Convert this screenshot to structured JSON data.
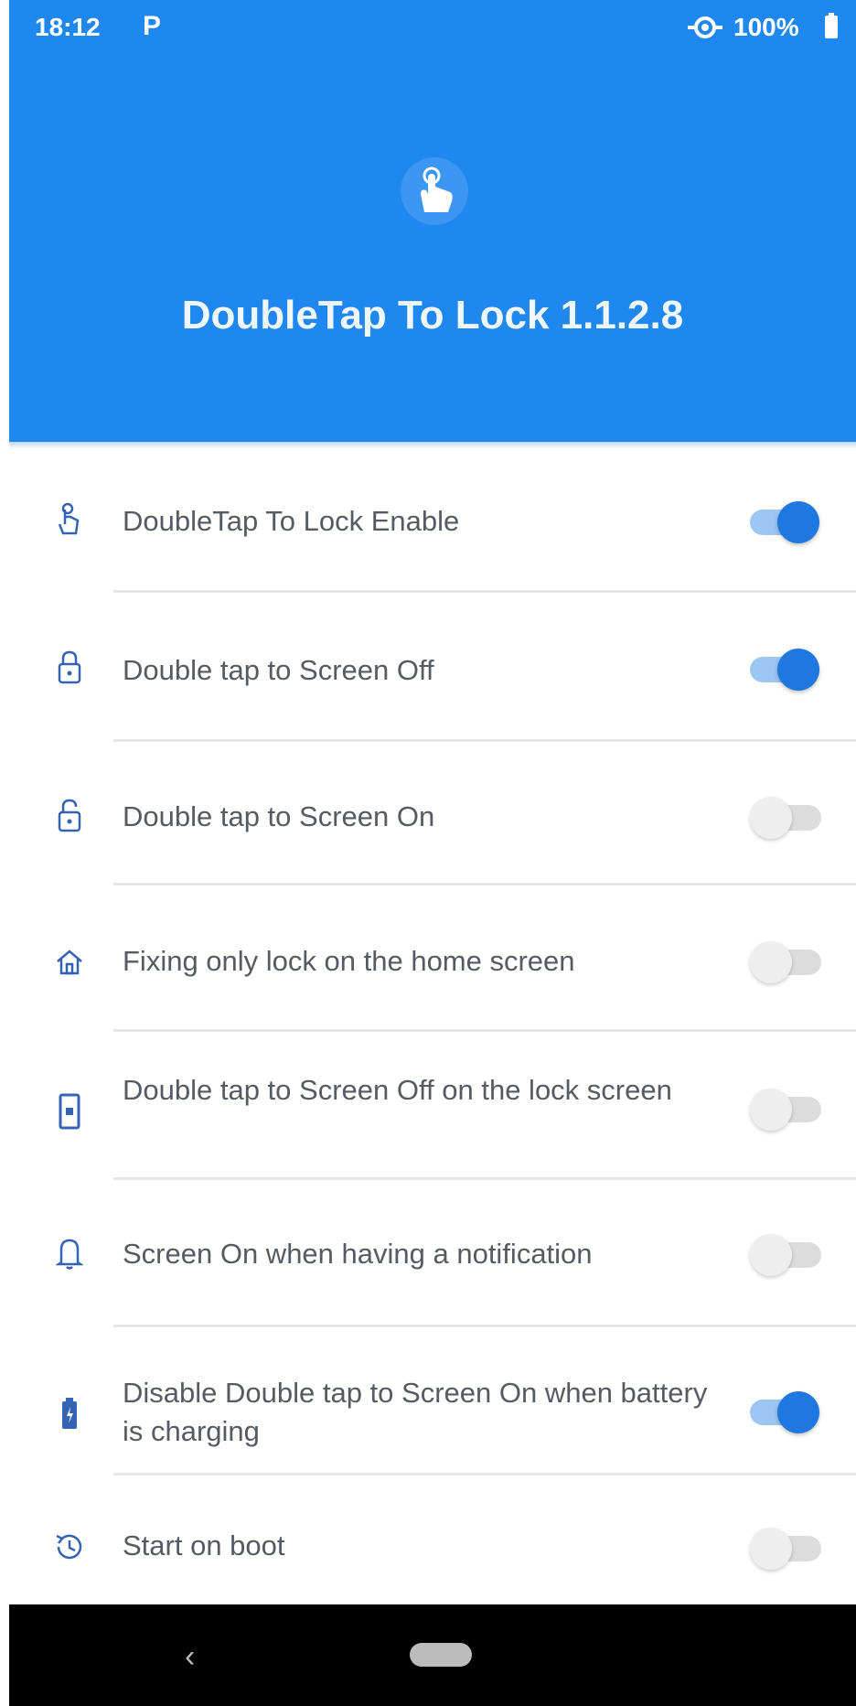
{
  "status_bar": {
    "time": "18:12",
    "notification_icon": "P",
    "battery": "100%"
  },
  "header": {
    "icon": "tap-icon",
    "title": "DoubleTap To Lock 1.1.2.8",
    "color": "#1e88f0"
  },
  "settings": [
    {
      "icon": "tap-icon",
      "label": "DoubleTap To Lock Enable",
      "enabled": true
    },
    {
      "icon": "lock-icon",
      "label": "Double tap to Screen Off",
      "enabled": true
    },
    {
      "icon": "lock-icon",
      "label": "Double tap to Screen On",
      "enabled": false
    },
    {
      "icon": "home-icon",
      "label": "Fixing only lock on the home screen",
      "enabled": false
    },
    {
      "icon": "phone-icon",
      "label": "Double tap to Screen Off on the lock screen",
      "enabled": false
    },
    {
      "icon": "bell-icon",
      "label": "Screen On when having a notification",
      "enabled": false
    },
    {
      "icon": "battery-icon",
      "label": "Disable Double tap to Screen On when battery is charging",
      "enabled": true
    },
    {
      "icon": "history-icon",
      "label": "Start on boot",
      "enabled": false
    }
  ],
  "accent_color": "#1f77e0"
}
